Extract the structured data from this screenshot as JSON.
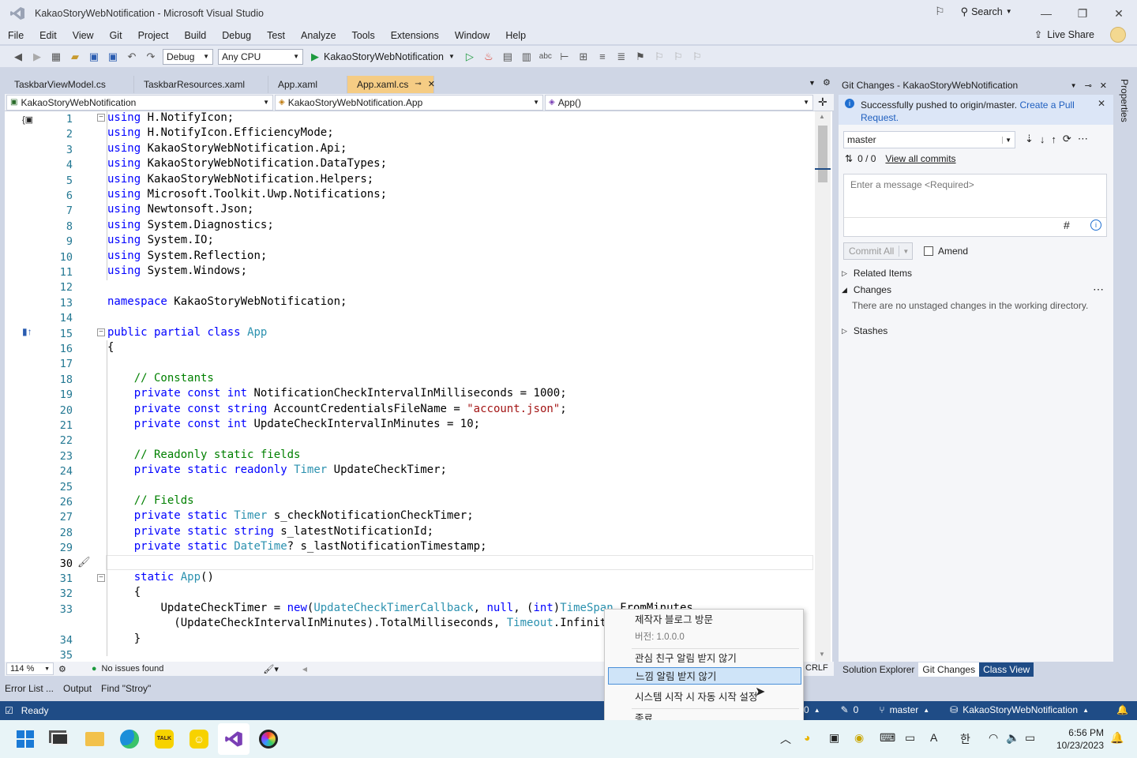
{
  "window": {
    "title": "KakaoStoryWebNotification - Microsoft Visual Studio",
    "search_label": "Search",
    "live_share": "Live Share"
  },
  "menu": [
    "File",
    "Edit",
    "View",
    "Git",
    "Project",
    "Build",
    "Debug",
    "Test",
    "Analyze",
    "Tools",
    "Extensions",
    "Window",
    "Help"
  ],
  "toolbar": {
    "config": "Debug",
    "platform": "Any CPU",
    "run_target": "KakaoStoryWebNotification"
  },
  "doc_tabs": [
    "TaskbarViewModel.cs",
    "TaskbarResources.xaml",
    "App.xaml",
    "App.xaml.cs"
  ],
  "nav": {
    "project": "KakaoStoryWebNotification",
    "class": "KakaoStoryWebNotification.App",
    "member": "App()"
  },
  "code_lines": [
    {
      "n": "1",
      "t": "using H.NotifyIcon;"
    },
    {
      "n": "2",
      "t": "using H.NotifyIcon.EfficiencyMode;"
    },
    {
      "n": "3",
      "t": "using KakaoStoryWebNotification.Api;"
    },
    {
      "n": "4",
      "t": "using KakaoStoryWebNotification.DataTypes;"
    },
    {
      "n": "5",
      "t": "using KakaoStoryWebNotification.Helpers;"
    },
    {
      "n": "6",
      "t": "using Microsoft.Toolkit.Uwp.Notifications;"
    },
    {
      "n": "7",
      "t": "using Newtonsoft.Json;"
    },
    {
      "n": "8",
      "t": "using System.Diagnostics;"
    },
    {
      "n": "9",
      "t": "using System.IO;"
    },
    {
      "n": "10",
      "t": "using System.Reflection;"
    },
    {
      "n": "11",
      "t": "using System.Windows;"
    },
    {
      "n": "12",
      "t": ""
    },
    {
      "n": "13",
      "t": "namespace KakaoStoryWebNotification;"
    },
    {
      "n": "14",
      "t": ""
    },
    {
      "n": "15",
      "t": "public partial class App"
    },
    {
      "n": "16",
      "t": "{"
    },
    {
      "n": "17",
      "t": ""
    },
    {
      "n": "18",
      "t": "    // Constants"
    },
    {
      "n": "19",
      "t": "    private const int NotificationCheckIntervalInMilliseconds = 1000;"
    },
    {
      "n": "20",
      "t": "    private const string AccountCredentialsFileName = \"account.json\";"
    },
    {
      "n": "21",
      "t": "    private const int UpdateCheckIntervalInMinutes = 10;"
    },
    {
      "n": "22",
      "t": ""
    },
    {
      "n": "23",
      "t": "    // Readonly static fields"
    },
    {
      "n": "24",
      "t": "    private static readonly Timer UpdateCheckTimer;"
    },
    {
      "n": "25",
      "t": ""
    },
    {
      "n": "26",
      "t": "    // Fields"
    },
    {
      "n": "27",
      "t": "    private static Timer s_checkNotificationCheckTimer;"
    },
    {
      "n": "28",
      "t": "    private static string s_latestNotificationId;"
    },
    {
      "n": "29",
      "t": "    private static DateTime? s_lastNotificationTimestamp;"
    },
    {
      "n": "30",
      "t": ""
    },
    {
      "n": "31",
      "t": "    static App()"
    },
    {
      "n": "32",
      "t": "    {"
    },
    {
      "n": "33",
      "t": "        UpdateCheckTimer = new(UpdateCheckTimerCallback, null, (int)TimeSpan.FromMinutes"
    },
    {
      "n": "",
      "t": "          (UpdateCheckIntervalInMinutes).TotalMilliseconds, Timeout.Infinite);"
    },
    {
      "n": "34",
      "t": "    }"
    },
    {
      "n": "35",
      "t": ""
    }
  ],
  "editor_status": {
    "zoom": "114 %",
    "issues": "No issues found",
    "eol": "CRLF"
  },
  "bottom_tabs": [
    "Error List ...",
    "Output",
    "Find \"Stroy\""
  ],
  "statusbar": {
    "ready": "Ready",
    "errors": "0",
    "branch": "master",
    "repo": "KakaoStoryWebNotification",
    "pencil_count": "0"
  },
  "git": {
    "header": "Git Changes - KakaoStoryWebNotification",
    "info_text": "Successfully pushed to origin/master.",
    "info_link": "Create a Pull Request.",
    "branch": "master",
    "commits_count": "0 / 0",
    "view_all": "View all commits",
    "message_placeholder": "Enter a message <Required>",
    "commit_all": "Commit All",
    "amend": "Amend",
    "related_items": "Related Items",
    "changes": "Changes",
    "no_changes": "There are no unstaged changes in the working directory.",
    "stashes": "Stashes"
  },
  "panel_tabs": [
    "Solution Explorer",
    "Git Changes",
    "Class View"
  ],
  "properties_label": "Properties",
  "context_menu": {
    "visit_blog": "제작자 블로그 방문",
    "version": "버전: 1.0.0.0",
    "no_friend_alert": "관심 친구 알림 받지 않기",
    "no_emotion_alert": "느낌 알림 받지 않기",
    "autostart": "시스템 시작 시 자동 시작 설정",
    "exit": "종료"
  },
  "taskbar": {
    "time": "6:56 PM",
    "date": "10/23/2023",
    "ime": "한"
  },
  "colors": {
    "accent": "#1f4c86",
    "active_tab": "#f5cc84",
    "keyword": "#0000ff",
    "type": "#2b91af",
    "comment": "#008000",
    "string": "#a31515"
  }
}
